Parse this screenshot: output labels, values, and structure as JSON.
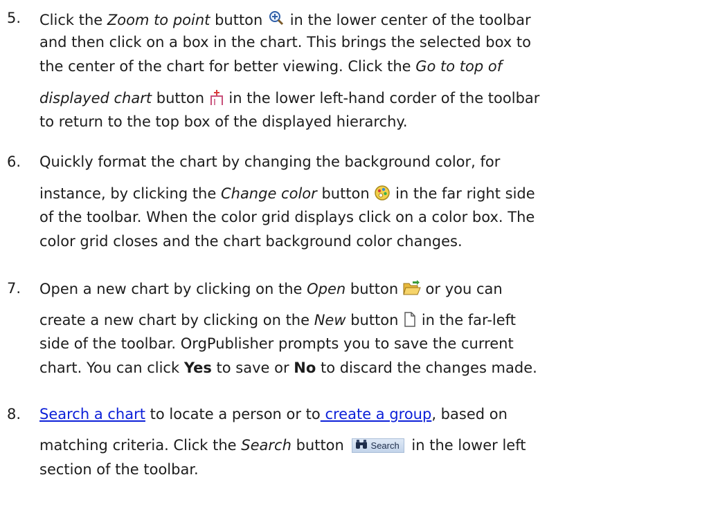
{
  "step5": {
    "number": "5.",
    "l1_a": "Click the ",
    "l1_em": "Zoom to point",
    "l1_b": " button",
    "l1_c": " in the lower center of the toolbar",
    "l2": "and then click on a box in the chart. This brings the selected box to",
    "l3_a": "the center of the chart for better viewing. Click the ",
    "l3_em": "Go to top of",
    "l4_em": "displayed chart",
    "l4_b": " button",
    "l4_c": " in the lower left-hand corder of the toolbar",
    "l5": "to return to the top box of the displayed hierarchy."
  },
  "step6": {
    "number": "6.",
    "l1": "Quickly format the chart by changing the background color, for",
    "l2_a": "instance, by clicking the ",
    "l2_em": "Change color",
    "l2_b": " button",
    "l2_c": " in the far right side",
    "l3": "of the toolbar. When the color grid displays click on a color box. The",
    "l4": "color grid closes and the chart background color changes."
  },
  "step7": {
    "number": "7.",
    "l1_a": "Open a new chart by clicking on the ",
    "l1_em": "Open",
    "l1_b": " button",
    "l1_c": " or you can",
    "l2_a": "create a new chart by clicking on the ",
    "l2_em": "New",
    "l2_b": " button",
    "l2_c": " in the far-left",
    "l3": "side of the toolbar. OrgPublisher prompts you to save the current",
    "l4_a": "chart. You can click ",
    "l4_yes": "Yes",
    "l4_b": " to save or ",
    "l4_no": "No",
    "l4_c": " to discard the changes made."
  },
  "step8": {
    "number": "8.",
    "link_search": "Search a chart",
    "l1_a": " to locate a person or to",
    "link_group": " create a group",
    "l1_b": ", based on",
    "l2_a": "matching criteria. Click the ",
    "l2_em": "Search",
    "l2_b": " button",
    "l2_c": " in the lower left",
    "search_btn_label": "Search",
    "l3": "section of the toolbar."
  },
  "icons": {
    "zoom": "zoom-to-point-icon",
    "top": "go-to-top-icon",
    "color": "change-color-icon",
    "open": "open-folder-icon",
    "new": "new-document-icon",
    "search": "binoculars-icon"
  }
}
